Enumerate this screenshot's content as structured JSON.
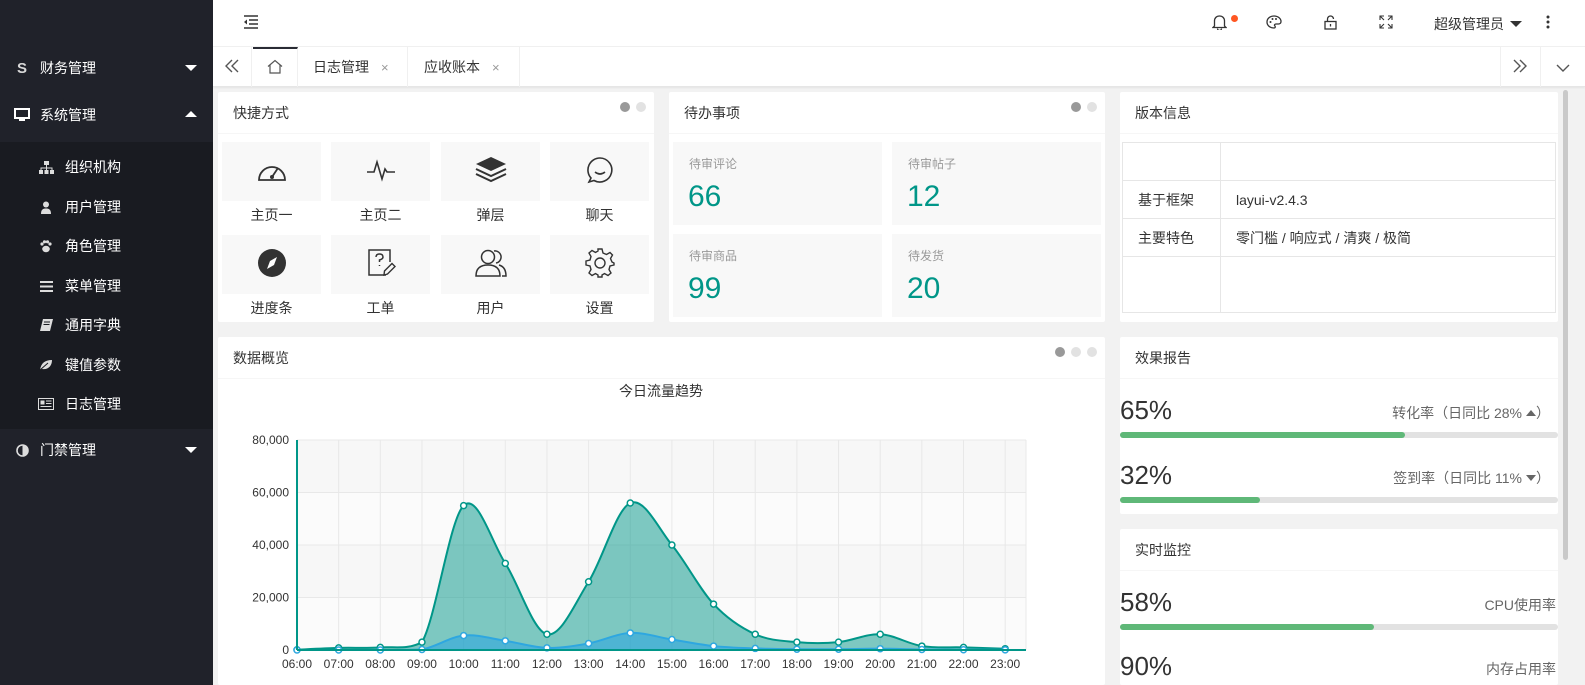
{
  "sidebar": {
    "items": [
      {
        "label": "财务管理",
        "icon": "s-icon",
        "expanded": false
      },
      {
        "label": "系统管理",
        "icon": "monitor-icon",
        "expanded": true
      },
      {
        "label": "门禁管理",
        "icon": "contrast-icon",
        "expanded": false
      }
    ],
    "sub_items": [
      {
        "label": "组织机构",
        "icon": "sitemap-icon"
      },
      {
        "label": "用户管理",
        "icon": "user-icon"
      },
      {
        "label": "角色管理",
        "icon": "paw-icon"
      },
      {
        "label": "菜单管理",
        "icon": "list-icon"
      },
      {
        "label": "通用字典",
        "icon": "book-icon"
      },
      {
        "label": "键值参数",
        "icon": "leaf-icon"
      },
      {
        "label": "日志管理",
        "icon": "newspaper-icon"
      }
    ]
  },
  "header": {
    "user_label": "超级管理员"
  },
  "tabs": [
    {
      "label": "日志管理",
      "close": "×"
    },
    {
      "label": "应收账本",
      "close": "×"
    }
  ],
  "shortcuts": {
    "title": "快捷方式",
    "items": [
      {
        "label": "主页一",
        "icon": "dashboard-icon"
      },
      {
        "label": "主页二",
        "icon": "pulse-icon"
      },
      {
        "label": "弹层",
        "icon": "layers-icon"
      },
      {
        "label": "聊天",
        "icon": "chat-smile-icon"
      },
      {
        "label": "进度条",
        "icon": "compass-icon"
      },
      {
        "label": "工单",
        "icon": "ticket-edit-icon"
      },
      {
        "label": "用户",
        "icon": "users-icon"
      },
      {
        "label": "设置",
        "icon": "gear-icon"
      }
    ]
  },
  "todo": {
    "title": "待办事项",
    "items": [
      {
        "label": "待审评论",
        "value": "66"
      },
      {
        "label": "待审帖子",
        "value": "12"
      },
      {
        "label": "待审商品",
        "value": "99"
      },
      {
        "label": "待发货",
        "value": "20"
      }
    ]
  },
  "version": {
    "title": "版本信息",
    "rows": [
      {
        "key": "",
        "value": ""
      },
      {
        "key": "基于框架",
        "value": "layui-v2.4.3"
      },
      {
        "key": "主要特色",
        "value": "零门槛 / 响应式 / 清爽 / 极简"
      },
      {
        "key": "",
        "value": ""
      }
    ]
  },
  "overview": {
    "title": "数据概览"
  },
  "report": {
    "title": "效果报告",
    "rows": [
      {
        "percent_label": "65%",
        "value": 65,
        "desc": "转化率（日同比 28%",
        "trend": "up"
      },
      {
        "percent_label": "32%",
        "value": 32,
        "desc": "签到率（日同比 11%",
        "trend": "down"
      }
    ]
  },
  "monitor": {
    "title": "实时监控",
    "rows": [
      {
        "percent_label": "58%",
        "value": 58,
        "desc": "CPU使用率"
      },
      {
        "percent_label": "90%",
        "value": 90,
        "desc": "内存占用率"
      }
    ]
  },
  "colors": {
    "accent": "#009688",
    "progress": "#5fb878",
    "sidebar_bg": "#20222a",
    "series1": "#009688",
    "series2": "#2ea7e0"
  },
  "chart_data": {
    "type": "area",
    "title": "今日流量趋势",
    "xlabel": "",
    "ylabel": "",
    "categories": [
      "06:00",
      "07:00",
      "08:00",
      "09:00",
      "10:00",
      "11:00",
      "12:00",
      "13:00",
      "14:00",
      "15:00",
      "16:00",
      "17:00",
      "18:00",
      "19:00",
      "20:00",
      "21:00",
      "22:00",
      "23:00"
    ],
    "y_ticks": [
      "0",
      "20,000",
      "40,000",
      "60,000",
      "80,000"
    ],
    "ylim": [
      0,
      80000
    ],
    "grid": true,
    "series": [
      {
        "values": [
          100,
          800,
          1000,
          3000,
          55000,
          33000,
          6000,
          26000,
          56000,
          40000,
          17500,
          6000,
          3000,
          3000,
          6000,
          1500,
          1000,
          500
        ],
        "color": "#009688"
      },
      {
        "values": [
          0,
          0,
          0,
          200,
          5500,
          3500,
          800,
          2500,
          6500,
          4000,
          1500,
          600,
          300,
          300,
          500,
          200,
          100,
          50
        ],
        "color": "#2ea7e0"
      }
    ]
  }
}
